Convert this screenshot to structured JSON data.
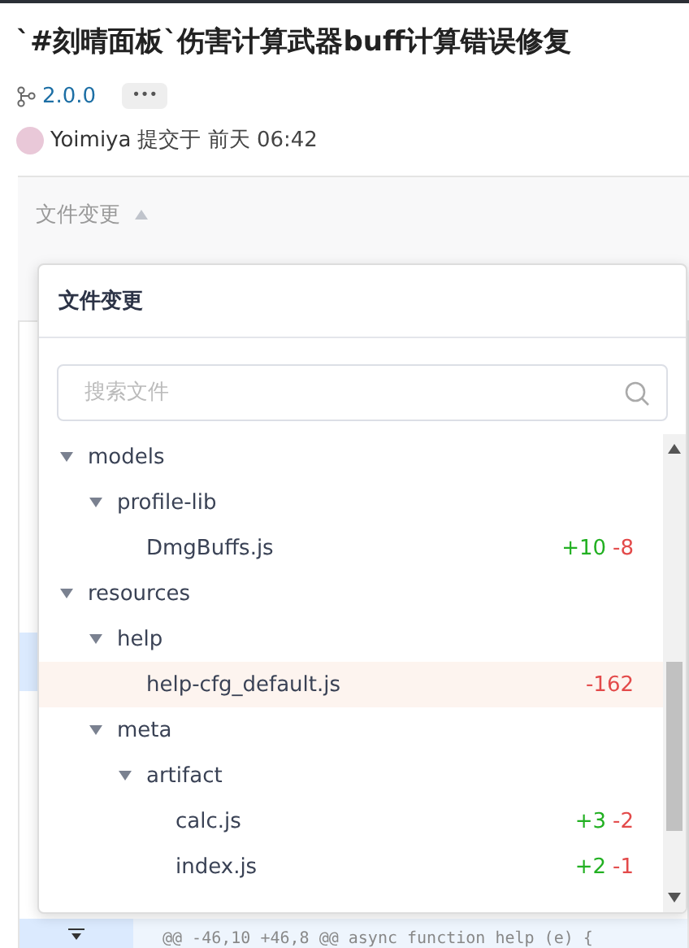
{
  "title": "`#刻晴面板`伤害计算武器buff计算错误修复",
  "version": {
    "label": "2.0.0",
    "more": "•••"
  },
  "commit": {
    "author": "Yoimiya",
    "text": "提交于 前天 06:42"
  },
  "file_changes_toggle": {
    "label": "文件变更",
    "expanded": true
  },
  "hunk_header": "@@ -46,10 +46,8 @@ async function help (e) {",
  "popup": {
    "title": "文件变更",
    "search": {
      "placeholder": "搜索文件"
    },
    "tree": [
      {
        "kind": "folder",
        "name": "models",
        "expanded": true,
        "children": [
          {
            "kind": "folder",
            "name": "profile-lib",
            "expanded": true,
            "children": [
              {
                "kind": "file",
                "name": "DmgBuffs.js",
                "selected": false,
                "additions": "+10",
                "deletions": "-8"
              }
            ]
          }
        ]
      },
      {
        "kind": "folder",
        "name": "resources",
        "expanded": true,
        "children": [
          {
            "kind": "folder",
            "name": "help",
            "expanded": true,
            "children": [
              {
                "kind": "file",
                "name": "help-cfg_default.js",
                "selected": true,
                "deletions": "-162"
              }
            ]
          },
          {
            "kind": "folder",
            "name": "meta",
            "expanded": true,
            "children": [
              {
                "kind": "folder",
                "name": "artifact",
                "expanded": true,
                "children": [
                  {
                    "kind": "file",
                    "name": "calc.js",
                    "selected": false,
                    "additions": "+3",
                    "deletions": "-2"
                  },
                  {
                    "kind": "file",
                    "name": "index.js",
                    "selected": false,
                    "additions": "+2",
                    "deletions": "-1"
                  }
                ]
              }
            ]
          }
        ]
      }
    ]
  }
}
